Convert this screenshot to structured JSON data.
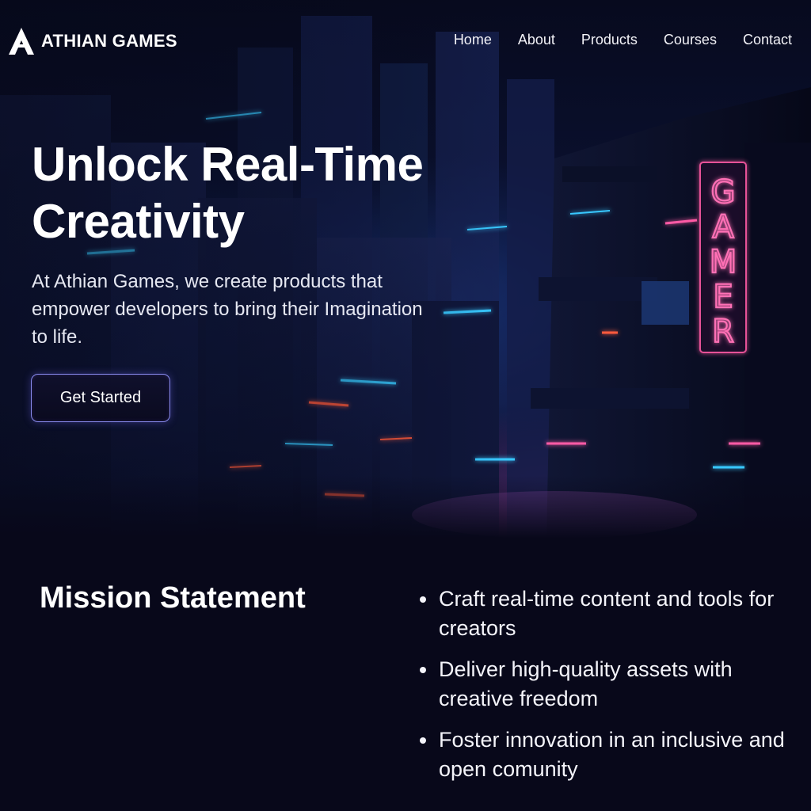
{
  "brand": {
    "name": "ATHIAN GAMES",
    "logo_icon": "triangle-a-logo-icon"
  },
  "nav": {
    "items": [
      {
        "label": "Home"
      },
      {
        "label": "About"
      },
      {
        "label": "Products"
      },
      {
        "label": "Courses"
      },
      {
        "label": "Contact"
      }
    ]
  },
  "hero": {
    "headline": "Unlock Real-Time Creativity",
    "subtext": "At Athian Games, we create products that empower developers to bring their Imagination to life.",
    "cta_label": "Get Started",
    "neon_sign": "GAMER"
  },
  "mission": {
    "title": "Mission Statement",
    "items": [
      "Craft real-time content and tools for creators",
      "Deliver high-quality assets with creative freedom",
      "Foster innovation in an inclusive and open comunity"
    ]
  },
  "colors": {
    "background": "#08081a",
    "accent": "#8a8cf0",
    "neon_pink": "#ff5aa5",
    "neon_cyan": "#38c8ff"
  }
}
